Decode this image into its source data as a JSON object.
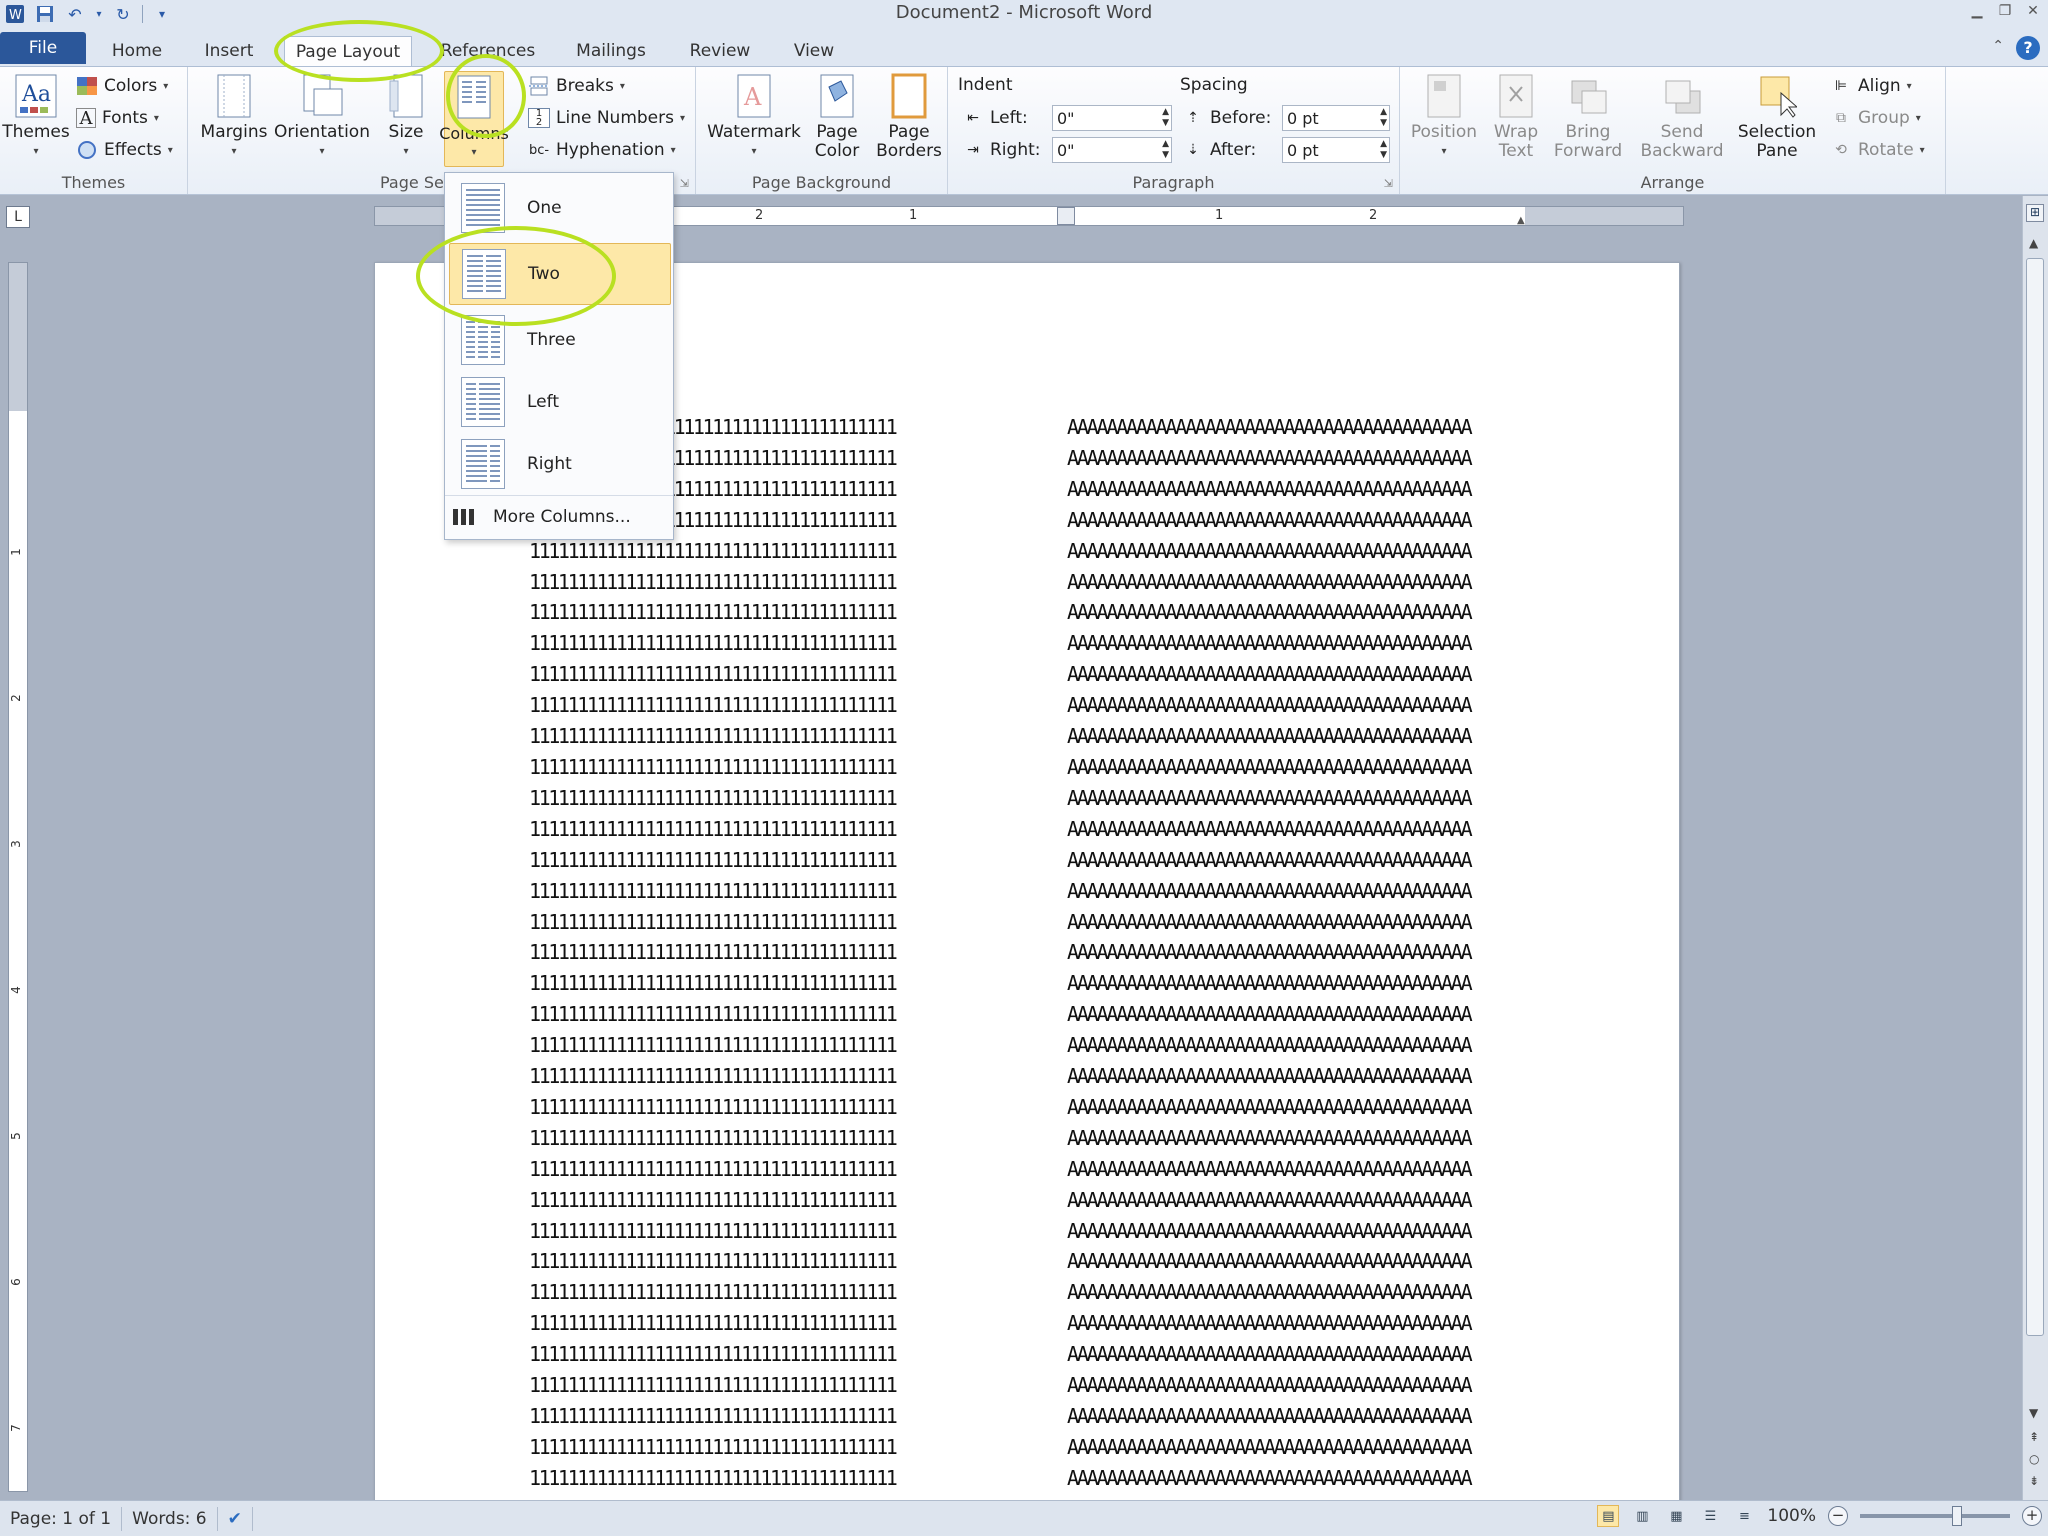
{
  "window": {
    "title": "Document2 - Microsoft Word",
    "quick_access": [
      "word-app-icon",
      "save-icon",
      "undo-icon",
      "redo-icon",
      "customize-icon"
    ]
  },
  "tabs": {
    "file": "File",
    "home": "Home",
    "insert": "Insert",
    "page_layout": "Page Layout",
    "references": "References",
    "mailings": "Mailings",
    "review": "Review",
    "view": "View"
  },
  "ribbon": {
    "themes": {
      "themes_btn": "Themes",
      "colors": "Colors",
      "fonts": "Fonts",
      "effects": "Effects",
      "label": "Themes"
    },
    "page_setup": {
      "margins": "Margins",
      "orientation": "Orientation",
      "size": "Size",
      "columns": "Columns",
      "breaks": "Breaks",
      "line_numbers": "Line Numbers",
      "hyphenation": "Hyphenation",
      "label": "Page Se"
    },
    "page_background": {
      "watermark": "Watermark",
      "page_color_1": "Page",
      "page_color_2": "Color",
      "page_borders_1": "Page",
      "page_borders_2": "Borders",
      "label": "Page Background"
    },
    "paragraph": {
      "indent_header": "Indent",
      "left_label": "Left:",
      "left_value": "0\"",
      "right_label": "Right:",
      "right_value": "0\"",
      "spacing_header": "Spacing",
      "before_label": "Before:",
      "before_value": "0 pt",
      "after_label": "After:",
      "after_value": "0 pt",
      "label": "Paragraph"
    },
    "arrange": {
      "position": "Position",
      "wrap_1": "Wrap",
      "wrap_2": "Text",
      "bring_1": "Bring",
      "bring_2": "Forward",
      "send_1": "Send",
      "send_2": "Backward",
      "selection_1": "Selection",
      "selection_2": "Pane",
      "align": "Align",
      "group": "Group",
      "rotate": "Rotate",
      "label": "Arrange"
    }
  },
  "columns_menu": {
    "items": [
      "One",
      "Two",
      "Three",
      "Left",
      "Right"
    ],
    "selected": "Two",
    "more": "More Columns..."
  },
  "document": {
    "col1_line": "11111111111111111111111111111111111111",
    "col1_partial_line": "1111111111111111111111111",
    "col2_line": "AAAAAAAAAAAAAAAAAAAAAAAAAAAAAAAAAAAAAAAAA",
    "line_count": 36,
    "partial_lines": 4
  },
  "ruler": {
    "h_numbers": [
      "2",
      "1",
      "1",
      "2"
    ],
    "v_numbers": [
      "1",
      "2",
      "3",
      "4",
      "5",
      "6",
      "7"
    ]
  },
  "status": {
    "page": "Page: 1 of 1",
    "words": "Words: 6",
    "zoom": "100%"
  },
  "colors": {
    "accent": "#2b579a",
    "highlight_circle": "#b9e021",
    "selected_item": "#fde8a8"
  }
}
